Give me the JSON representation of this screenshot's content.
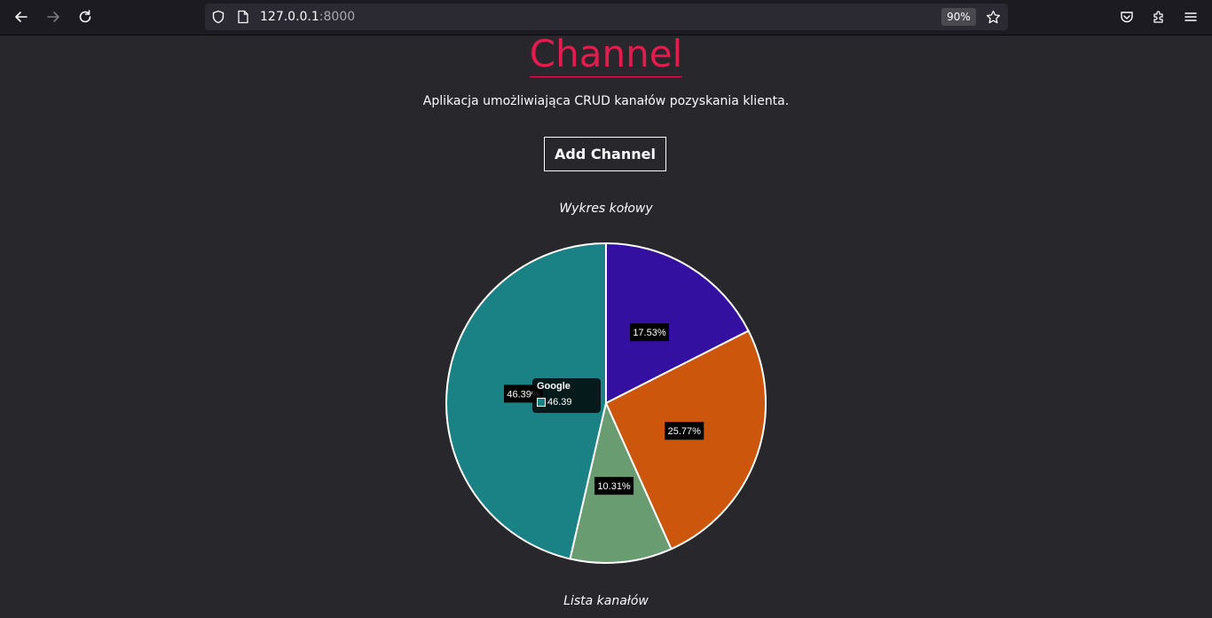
{
  "browser": {
    "url_host": "127.0.0.1",
    "url_port": ":8000",
    "zoom": "90%",
    "icons": [
      "back-arrow-icon",
      "forward-arrow-icon",
      "reload-icon",
      "shield-icon",
      "page-icon",
      "star-icon",
      "pocket-icon",
      "extensions-icon",
      "menu-icon"
    ]
  },
  "page": {
    "title": "Channel",
    "subtitle": "Aplikacja umożliwiająca CRUD kanałów pozyskania klienta.",
    "add_button": "Add Channel",
    "chart_caption": "Wykres kołowy",
    "list_caption": "Lista kanałów"
  },
  "colors": {
    "title": "#e31c4f",
    "background": "#28272b"
  },
  "chart_data": {
    "type": "pie",
    "title": "",
    "slices": [
      {
        "label": "",
        "value": 17.53,
        "display": "17.53%",
        "color": "#3310a0"
      },
      {
        "label": "",
        "value": 25.77,
        "display": "25.77%",
        "color": "#cc560c"
      },
      {
        "label": "",
        "value": 10.31,
        "display": "10.31%",
        "color": "#6a9c72"
      },
      {
        "label": "Google",
        "value": 46.39,
        "display": "46.39%",
        "color": "#1a8285"
      }
    ],
    "tooltip": {
      "label": "Google",
      "value": "46.39"
    }
  }
}
